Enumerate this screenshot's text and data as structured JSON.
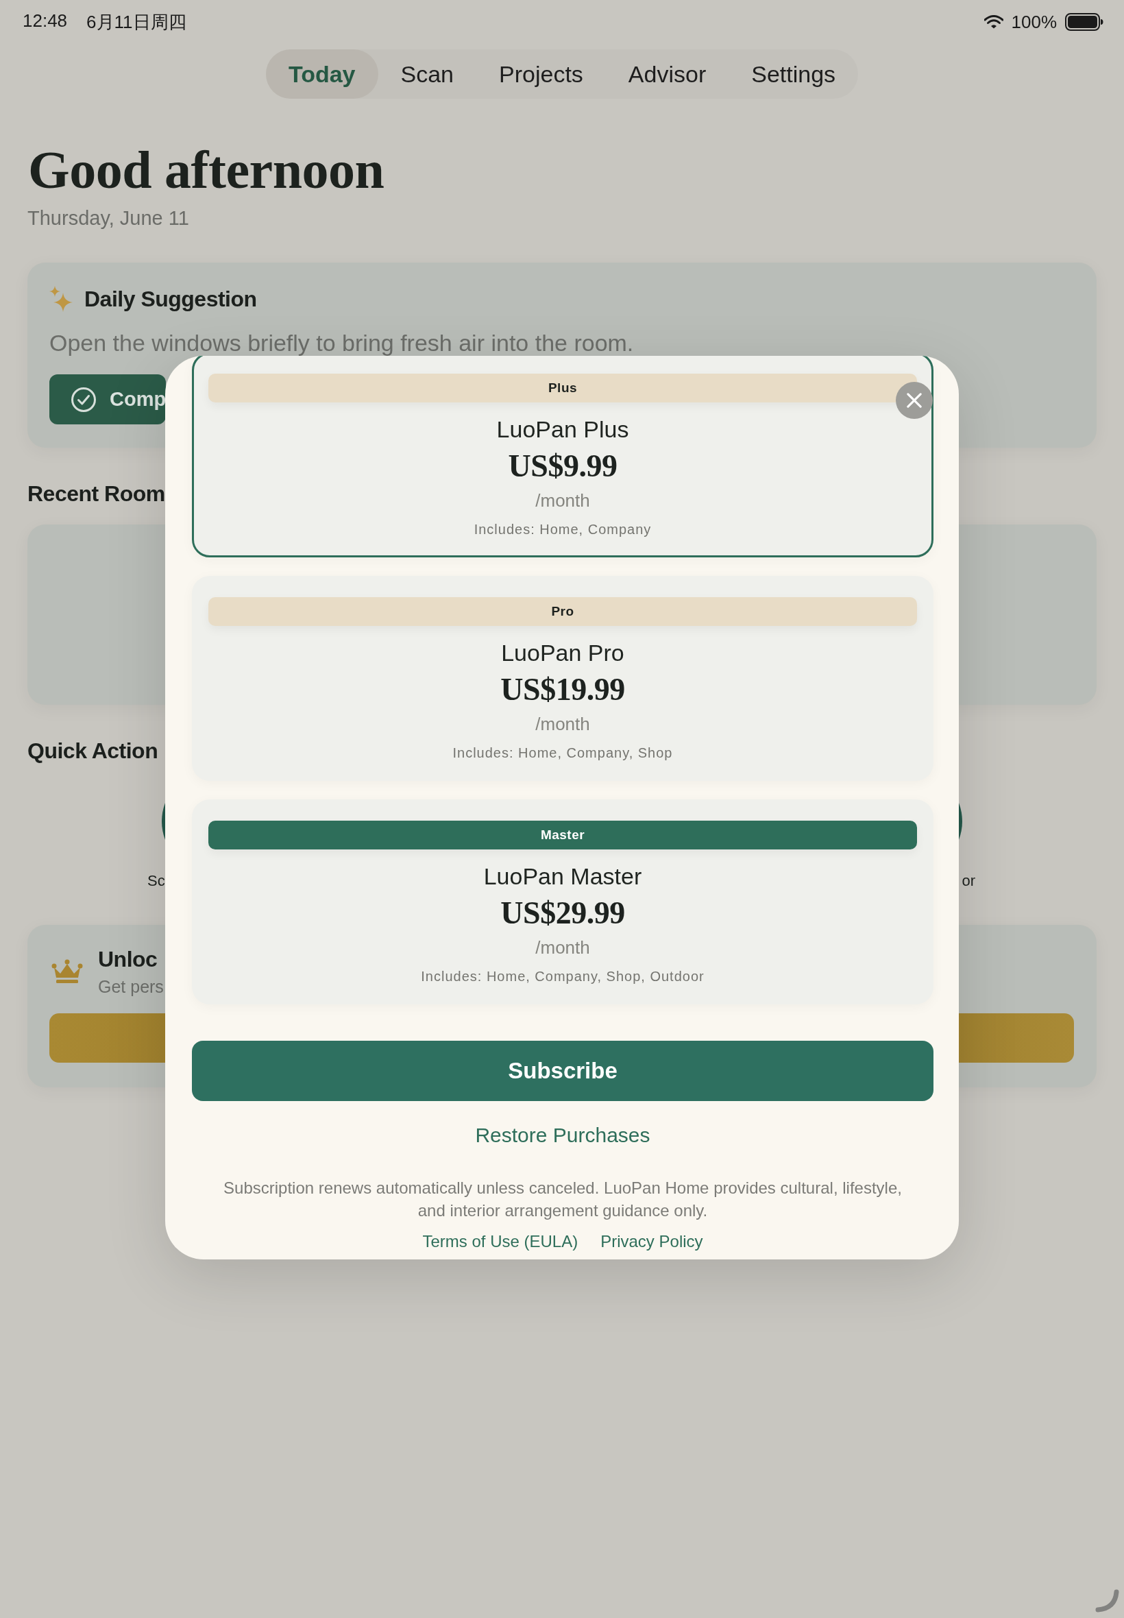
{
  "status_bar": {
    "time": "12:48",
    "date": "6月11日周四",
    "battery": "100%"
  },
  "tabs": [
    {
      "label": "Today",
      "selected": true
    },
    {
      "label": "Scan",
      "selected": false
    },
    {
      "label": "Projects",
      "selected": false
    },
    {
      "label": "Advisor",
      "selected": false
    },
    {
      "label": "Settings",
      "selected": false
    }
  ],
  "header": {
    "greeting": "Good afternoon",
    "date": "Thursday, June 11"
  },
  "daily_suggestion": {
    "title": "Daily Suggestion",
    "text": "Open the windows briefly to bring fresh air into the room.",
    "button": "Comp"
  },
  "recent_rooms": {
    "title": "Recent Room"
  },
  "quick_actions": {
    "title": "Quick Action",
    "items": [
      {
        "label": "Sc"
      },
      {
        "label": "or"
      }
    ]
  },
  "unlock": {
    "title": "Unloc",
    "subtitle": "Get pers"
  },
  "paywall": {
    "plans": [
      {
        "badge": "Plus",
        "name": "LuoPan Plus",
        "price": "US$9.99",
        "period": "/month",
        "includes": "Includes: Home, Company",
        "selected": true,
        "featured": false
      },
      {
        "badge": "Pro",
        "name": "LuoPan Pro",
        "price": "US$19.99",
        "period": "/month",
        "includes": "Includes: Home, Company, Shop",
        "selected": false,
        "featured": false
      },
      {
        "badge": "Master",
        "name": "LuoPan Master",
        "price": "US$29.99",
        "period": "/month",
        "includes": "Includes: Home, Company, Shop, Outdoor",
        "selected": false,
        "featured": true
      }
    ],
    "subscribe": "Subscribe",
    "restore": "Restore Purchases",
    "disclaimer": "Subscription renews automatically unless canceled. LuoPan Home provides cultural, lifestyle, and interior arrangement guidance only.",
    "links": [
      "Terms of Use (EULA)",
      "Privacy Policy"
    ]
  }
}
